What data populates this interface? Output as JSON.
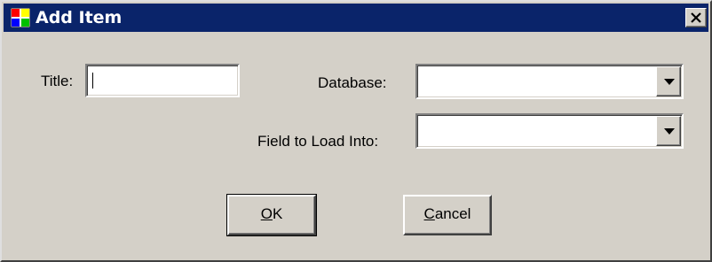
{
  "dialog": {
    "title": "Add Item",
    "icon": "app-window-icon",
    "close_icon": "close-x-icon"
  },
  "form": {
    "title_label": "Title:",
    "title_value": "",
    "database_label": "Database:",
    "database_value": "",
    "field_label": "Field to Load Into:",
    "field_value": ""
  },
  "buttons": {
    "ok": {
      "mnemonic": "O",
      "rest": "K"
    },
    "cancel": {
      "mnemonic": "C",
      "rest": "ancel"
    }
  },
  "colors": {
    "titlebar": "#0a246a",
    "face": "#d4d0c8"
  }
}
